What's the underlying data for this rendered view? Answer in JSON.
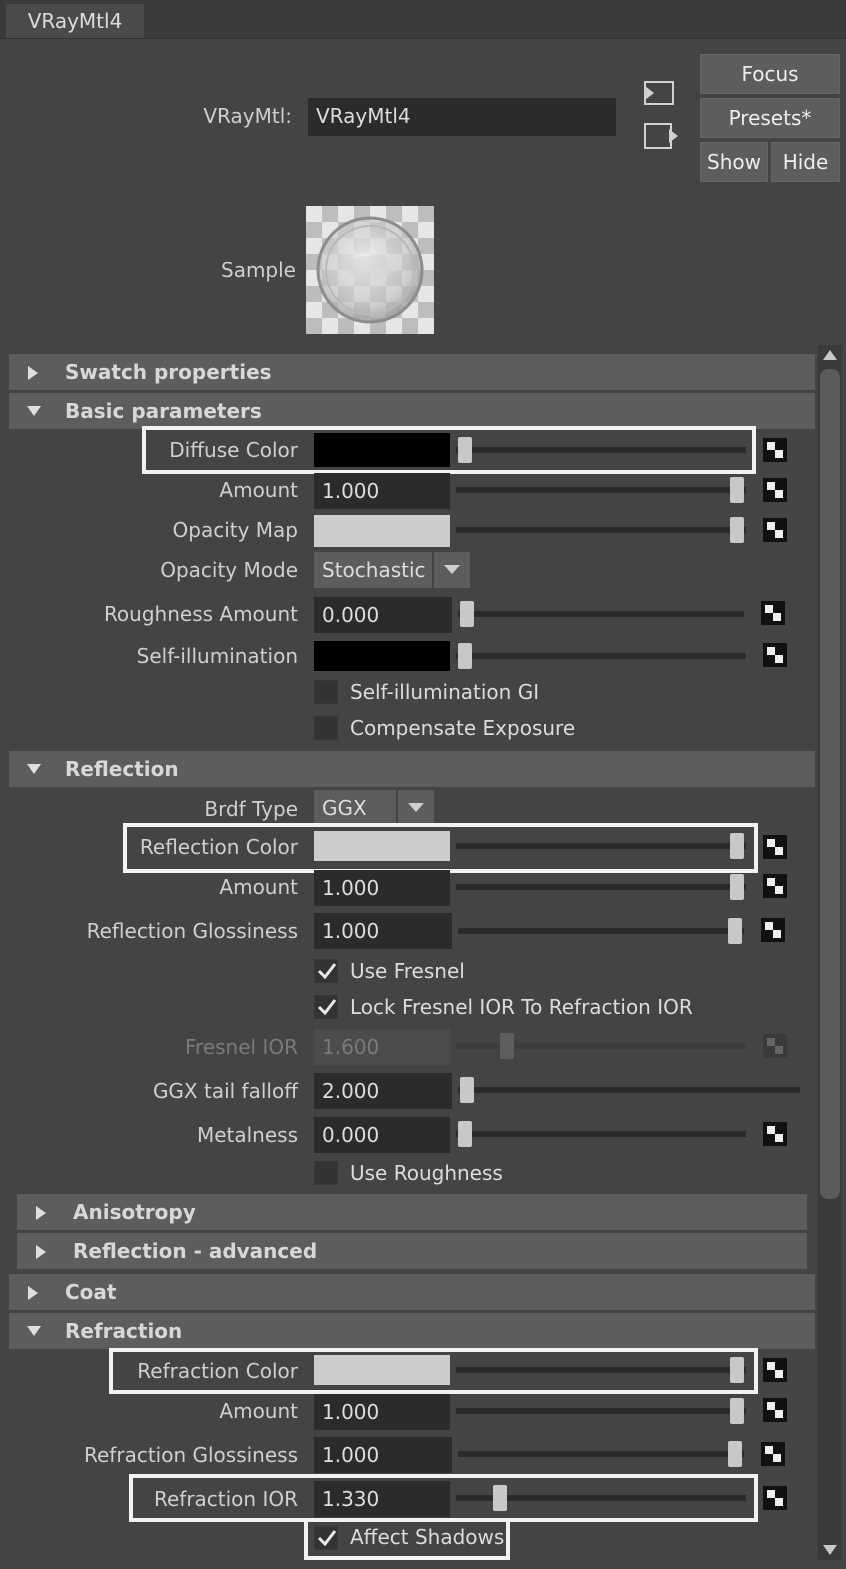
{
  "window": {
    "tab_label": "VRayMtl4"
  },
  "header": {
    "name_label": "VRayMtl:",
    "name_value": "VRayMtl4",
    "focus_label": "Focus",
    "presets_label": "Presets*",
    "show_label": "Show",
    "hide_label": "Hide",
    "sample_label": "Sample"
  },
  "sections": {
    "swatch": "Swatch properties",
    "basic": "Basic parameters",
    "reflection": "Reflection",
    "anisotropy": "Anisotropy",
    "reflection_adv": "Reflection - advanced",
    "coat": "Coat",
    "refraction": "Refraction"
  },
  "basic": {
    "diffuse_color": {
      "label": "Diffuse Color",
      "color": "#000000",
      "slider": 0.0
    },
    "amount": {
      "label": "Amount",
      "value": "1.000",
      "slider": 1.0
    },
    "opacity_map": {
      "label": "Opacity Map",
      "color": "#cccccc",
      "slider": 1.0
    },
    "opacity_mode": {
      "label": "Opacity Mode",
      "value": "Stochastic"
    },
    "roughness_amount": {
      "label": "Roughness Amount",
      "value": "0.000",
      "slider": 0.0
    },
    "self_illumination": {
      "label": "Self-illumination",
      "color": "#000000",
      "slider": 0.0
    },
    "self_illum_gi": {
      "label": "Self-illumination GI",
      "checked": false
    },
    "compensate_exposure": {
      "label": "Compensate Exposure",
      "checked": false
    }
  },
  "reflection": {
    "brdf_type": {
      "label": "Brdf Type",
      "value": "GGX"
    },
    "reflection_color": {
      "label": "Reflection Color",
      "color": "#cccccc",
      "slider": 1.0
    },
    "amount": {
      "label": "Amount",
      "value": "1.000",
      "slider": 1.0
    },
    "glossiness": {
      "label": "Reflection Glossiness",
      "value": "1.000",
      "slider": 1.0
    },
    "use_fresnel": {
      "label": "Use Fresnel",
      "checked": true
    },
    "lock_fresnel": {
      "label": "Lock Fresnel IOR To Refraction IOR",
      "checked": true
    },
    "fresnel_ior": {
      "label": "Fresnel IOR",
      "value": "1.600",
      "slider": 0.16
    },
    "ggx_tail": {
      "label": "GGX tail falloff",
      "value": "2.000",
      "slider": 0.0
    },
    "metalness": {
      "label": "Metalness",
      "value": "0.000",
      "slider": 0.0
    },
    "use_roughness": {
      "label": "Use Roughness",
      "checked": false
    }
  },
  "refraction": {
    "refraction_color": {
      "label": "Refraction Color",
      "color": "#cccccc",
      "slider": 1.0
    },
    "amount": {
      "label": "Amount",
      "value": "1.000",
      "slider": 1.0
    },
    "glossiness": {
      "label": "Refraction Glossiness",
      "value": "1.000",
      "slider": 1.0
    },
    "ior": {
      "label": "Refraction IOR",
      "value": "1.330",
      "slider": 0.14
    },
    "affect_shadows": {
      "label": "Affect Shadows",
      "checked": true
    }
  },
  "icons": {
    "map": "checker-map-icon",
    "triangle_right": "triangle-right-icon",
    "triangle_down": "triangle-down-icon",
    "copy": "copy-tab-icon",
    "paste": "paste-tab-icon",
    "checkmark": "checkmark-icon"
  }
}
